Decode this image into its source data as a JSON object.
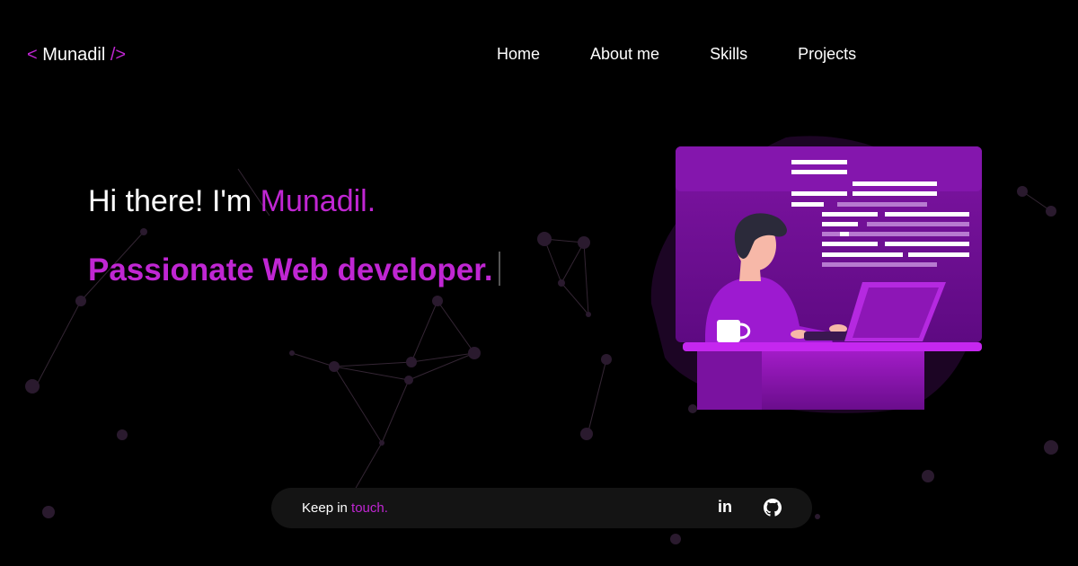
{
  "logo": {
    "open": "<",
    "name": "Munadil",
    "close": "/>"
  },
  "nav": {
    "items": [
      "Home",
      "About me",
      "Skills",
      "Projects"
    ]
  },
  "hero": {
    "greeting_prefix": "Hi there! I'm ",
    "greeting_name": "Munadil.",
    "role": "Passionate Web developer."
  },
  "contact": {
    "prefix": "Keep in ",
    "accent": "touch.",
    "linkedin_label": "in",
    "icons": [
      "linkedin-icon",
      "github-icon"
    ]
  },
  "colors": {
    "background": "#000000",
    "accent": "#c026d3",
    "bar": "#141414"
  }
}
